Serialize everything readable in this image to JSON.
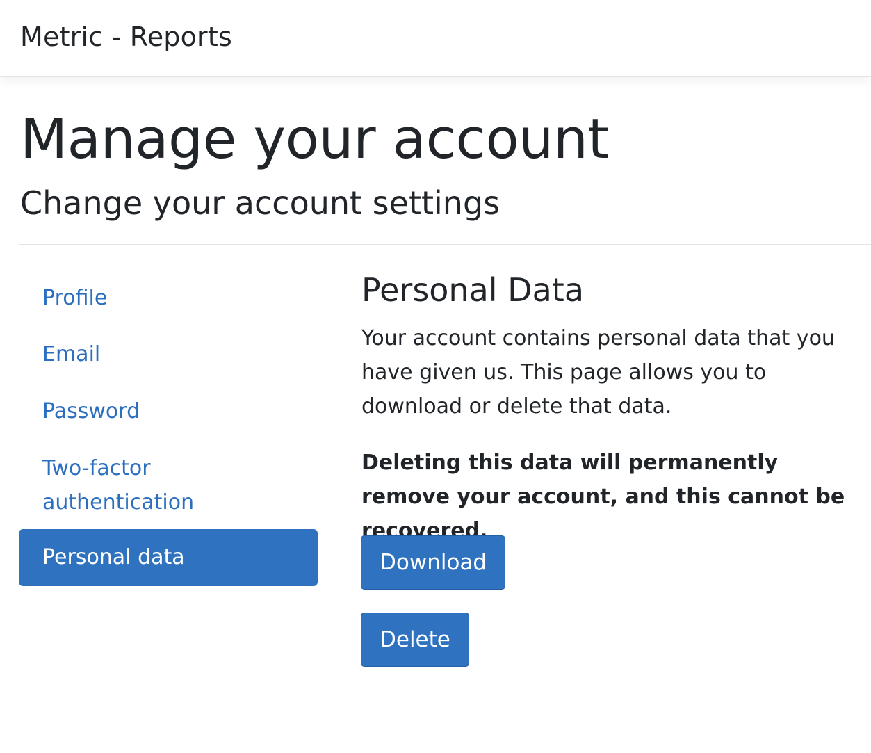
{
  "navbar": {
    "brand": "Metric - Reports"
  },
  "header": {
    "title": "Manage your account",
    "subtitle": "Change your account settings"
  },
  "sidebar": {
    "items": [
      {
        "label": "Profile",
        "active": false
      },
      {
        "label": "Email",
        "active": false
      },
      {
        "label": "Password",
        "active": false
      },
      {
        "label": "Two-factor\nauthentication",
        "active": false
      },
      {
        "label": "Personal data",
        "active": true
      }
    ]
  },
  "main": {
    "section_title": "Personal Data",
    "description": "Your account contains personal data that you have given us. This page allows you to download or delete that data.",
    "warning": "Deleting this data will permanently remove your account, and this cannot be recovered.",
    "download_label": "Download",
    "delete_label": "Delete"
  },
  "colors": {
    "primary": "#2f72c0",
    "link": "#2d6fbf",
    "text": "#212529"
  }
}
